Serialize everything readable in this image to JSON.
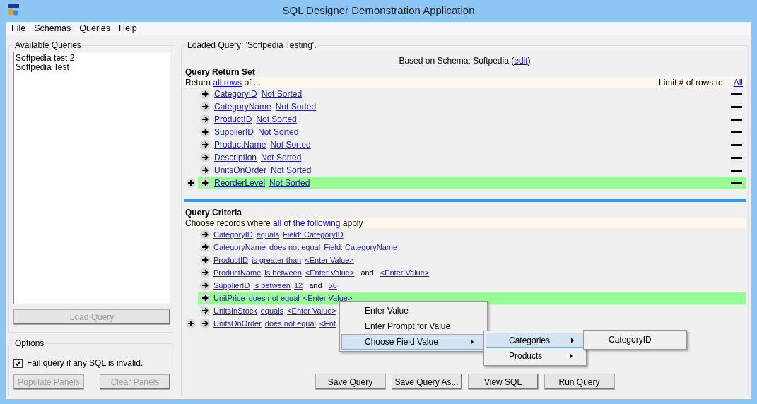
{
  "window": {
    "title": "SQL Designer Demonstration Application"
  },
  "menu": [
    "File",
    "Schemas",
    "Queries",
    "Help"
  ],
  "available_queries": {
    "title": "Available Queries",
    "items": [
      {
        "label": "Softpedia test 2",
        "selected": false
      },
      {
        "label": "Softpedia Test",
        "selected": false
      }
    ],
    "load_button": {
      "label": "Load Query",
      "disabled": true
    }
  },
  "options": {
    "title": "Options",
    "checkbox": {
      "label": "Fail query if any SQL is invalid.",
      "checked": true
    },
    "buttons": [
      {
        "label": "Populate Panels",
        "disabled": true
      },
      {
        "label": "Clear Panels",
        "disabled": true
      }
    ]
  },
  "query_panel": {
    "title": "Loaded Query: 'Softpedia Testing'.",
    "schema_line": {
      "before": "Based on Schema: Softpedia (",
      "link": "edit",
      "after": ")"
    },
    "return_set": {
      "heading": "Query Return Set",
      "sentence": {
        "before": "Return ",
        "link": "all rows",
        "after": " of ..."
      },
      "limit_label": "Limit # of rows to",
      "limit_link": "All",
      "rows": [
        {
          "field": "CategoryID",
          "sort": "Not Sorted",
          "selected": false,
          "add_button": false
        },
        {
          "field": "CategoryName",
          "sort": "Not Sorted",
          "selected": false,
          "add_button": false
        },
        {
          "field": "ProductID",
          "sort": "Not Sorted",
          "selected": false,
          "add_button": false
        },
        {
          "field": "SupplierID",
          "sort": "Not Sorted",
          "selected": false,
          "add_button": false
        },
        {
          "field": "ProductName",
          "sort": "Not Sorted",
          "selected": false,
          "add_button": false
        },
        {
          "field": "Description",
          "sort": "Not Sorted",
          "selected": false,
          "add_button": false
        },
        {
          "field": "UnitsOnOrder",
          "sort": "Not Sorted",
          "selected": false,
          "add_button": false
        },
        {
          "field": "ReorderLevel",
          "sort": "Not Sorted",
          "selected": true,
          "add_button": true
        }
      ]
    },
    "criteria": {
      "heading": "Query Criteria",
      "sentence": {
        "before": "Choose records where ",
        "link": "all of the following",
        "after": " apply"
      },
      "rows": [
        {
          "selected": false,
          "add_button": false,
          "parts": [
            {
              "kind": "link",
              "text": "CategoryID"
            },
            {
              "kind": "link",
              "text": "equals"
            },
            {
              "kind": "link",
              "text": "Field: CategoryID"
            }
          ]
        },
        {
          "selected": false,
          "add_button": false,
          "parts": [
            {
              "kind": "link",
              "text": "CategoryName"
            },
            {
              "kind": "link",
              "text": "does not equal"
            },
            {
              "kind": "link",
              "text": "Field: CategoryName"
            }
          ]
        },
        {
          "selected": false,
          "add_button": false,
          "parts": [
            {
              "kind": "link",
              "text": "ProductID"
            },
            {
              "kind": "link",
              "text": "is greater than"
            },
            {
              "kind": "link",
              "text": "<Enter Value>"
            }
          ]
        },
        {
          "selected": false,
          "add_button": false,
          "parts": [
            {
              "kind": "link",
              "text": "ProductName"
            },
            {
              "kind": "link",
              "text": "is between"
            },
            {
              "kind": "link",
              "text": "<Enter Value>"
            },
            {
              "kind": "text",
              "text": "and"
            },
            {
              "kind": "link",
              "text": "<Enter Value>"
            }
          ]
        },
        {
          "selected": false,
          "add_button": false,
          "parts": [
            {
              "kind": "link",
              "text": "SupplierID"
            },
            {
              "kind": "link",
              "text": "is between"
            },
            {
              "kind": "link",
              "text": "12"
            },
            {
              "kind": "text",
              "text": "and"
            },
            {
              "kind": "link",
              "text": "56"
            }
          ]
        },
        {
          "selected": true,
          "add_button": false,
          "parts": [
            {
              "kind": "link",
              "text": "UnitPrice"
            },
            {
              "kind": "link",
              "text": "does not equal"
            },
            {
              "kind": "link",
              "text": "<Enter Value>"
            }
          ]
        },
        {
          "selected": false,
          "add_button": false,
          "parts": [
            {
              "kind": "link",
              "text": "UnitsInStock"
            },
            {
              "kind": "link",
              "text": "equals"
            },
            {
              "kind": "link",
              "text": "<Enter Value>"
            }
          ]
        },
        {
          "selected": false,
          "add_button": true,
          "parts": [
            {
              "kind": "link",
              "text": "UnitsOnOrder"
            },
            {
              "kind": "link",
              "text": "does not equal"
            },
            {
              "kind": "link",
              "text": "<Ent"
            }
          ]
        }
      ]
    },
    "buttons": [
      "Save Query",
      "Save Query As...",
      "View SQL",
      "Run Query"
    ]
  },
  "context_menu": {
    "items": [
      {
        "label": "Enter Value",
        "selected": false,
        "has_submenu": false
      },
      {
        "label": "Enter Prompt for Value",
        "selected": false,
        "has_submenu": false
      },
      {
        "label": "Choose Field Value",
        "selected": true,
        "has_submenu": true
      }
    ]
  },
  "submenu": {
    "items": [
      {
        "label": "Categories",
        "selected": true,
        "has_submenu": true
      },
      {
        "label": "Products",
        "selected": false,
        "has_submenu": true
      }
    ]
  },
  "submenu_2": {
    "items": [
      {
        "label": "CategoryID",
        "selected": false,
        "has_submenu": false
      }
    ]
  }
}
